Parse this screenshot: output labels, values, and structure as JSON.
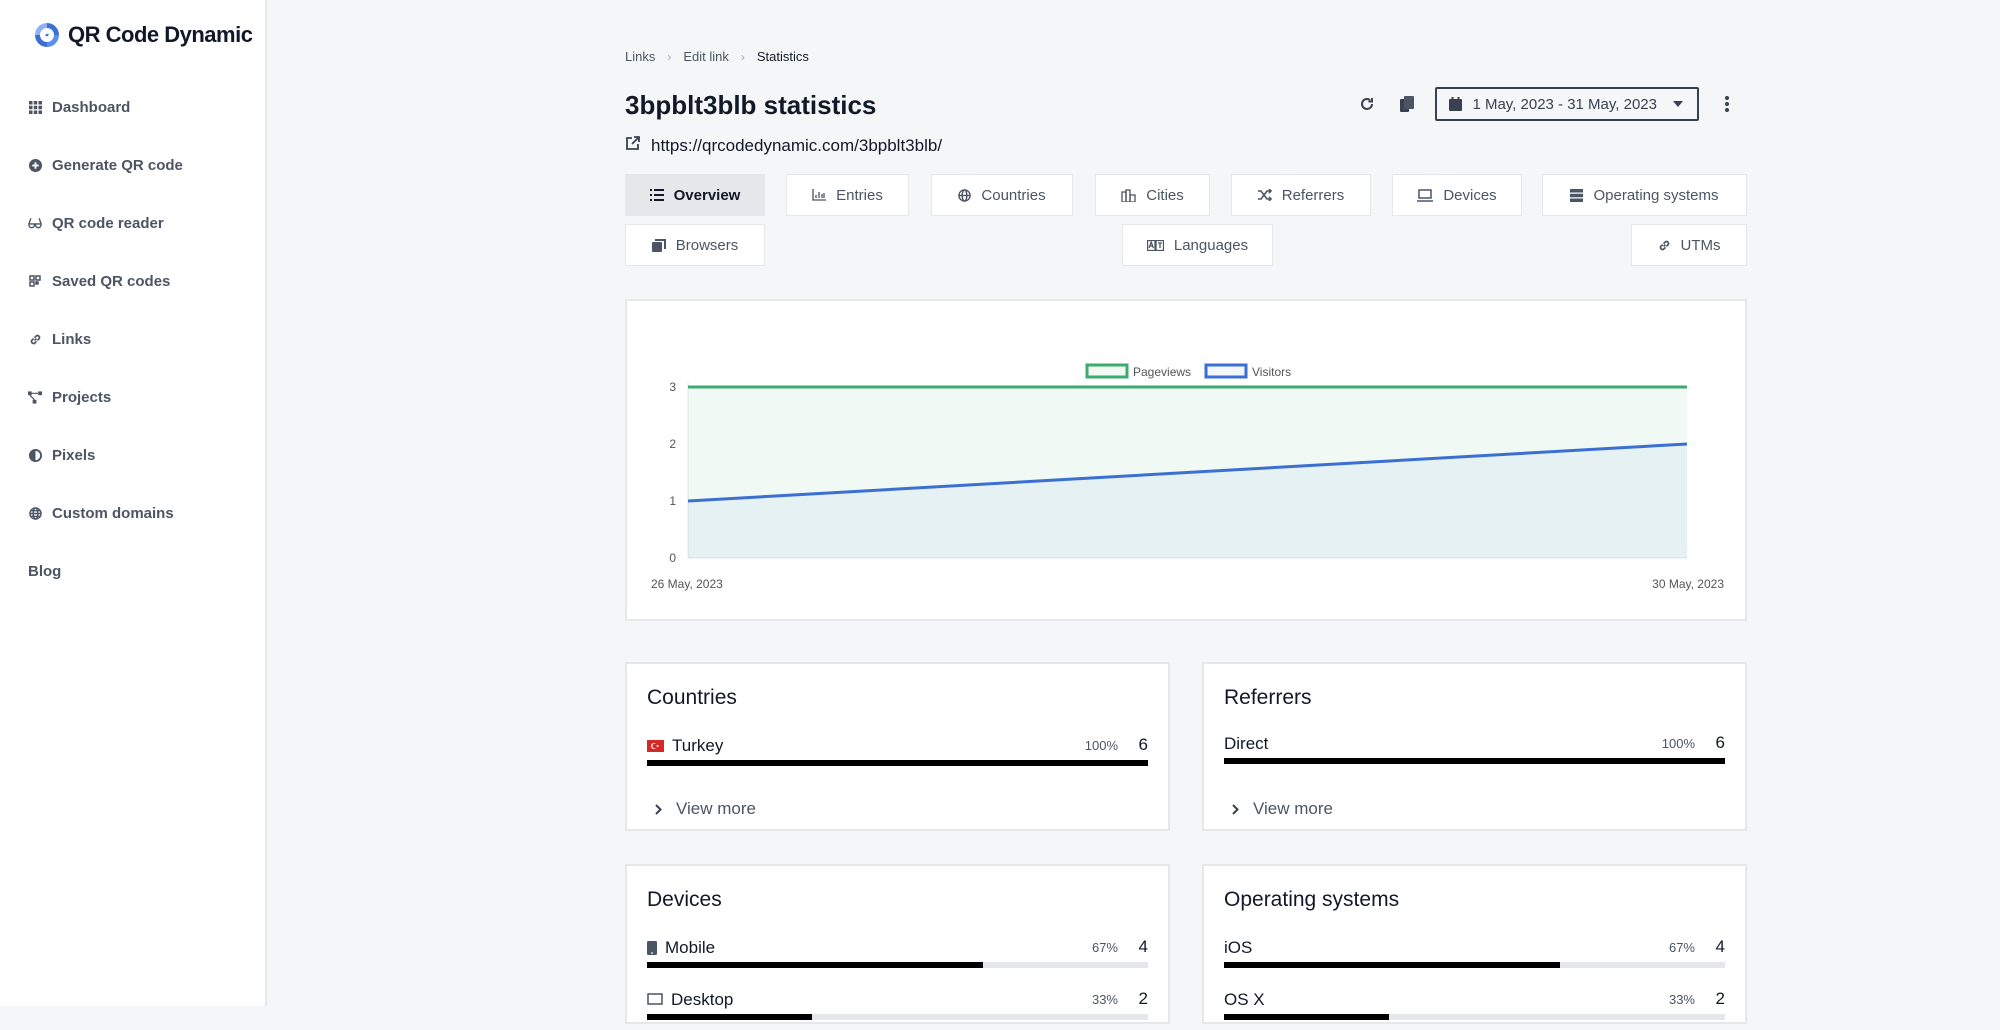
{
  "app": {
    "name": "QR Code Dynamic"
  },
  "sidebar": {
    "items": [
      {
        "label": "Dashboard",
        "icon": "grid-icon"
      },
      {
        "label": "Generate QR code",
        "icon": "plus-circle-icon"
      },
      {
        "label": "QR code reader",
        "icon": "glasses-icon"
      },
      {
        "label": "Saved QR codes",
        "icon": "qrcode-icon"
      },
      {
        "label": "Links",
        "icon": "link-icon"
      },
      {
        "label": "Projects",
        "icon": "project-diagram-icon"
      },
      {
        "label": "Pixels",
        "icon": "adjust-icon"
      },
      {
        "label": "Custom domains",
        "icon": "globe-icon"
      },
      {
        "label": "Blog",
        "icon": ""
      }
    ]
  },
  "breadcrumb": {
    "items": [
      "Links",
      "Edit link",
      "Statistics"
    ],
    "separator": "›"
  },
  "page": {
    "title": "3bpblt3blb statistics",
    "url": "https://qrcodedynamic.com/3bpblt3blb/"
  },
  "toolbar": {
    "refresh_icon": "refresh-icon",
    "copy_icon": "copy-icon",
    "date_range": "1 May, 2023 - 31 May, 2023",
    "more_icon": "more-vertical-icon"
  },
  "tabs": [
    {
      "label": "Overview",
      "icon": "list-icon",
      "active": true
    },
    {
      "label": "Entries",
      "icon": "chart-bar-icon"
    },
    {
      "label": "Countries",
      "icon": "globe-icon"
    },
    {
      "label": "Cities",
      "icon": "city-icon"
    },
    {
      "label": "Referrers",
      "icon": "random-icon"
    },
    {
      "label": "Devices",
      "icon": "laptop-icon"
    },
    {
      "label": "Operating systems",
      "icon": "server-icon"
    },
    {
      "label": "Browsers",
      "icon": "window-restore-icon"
    },
    {
      "label": "Languages",
      "icon": "language-icon"
    },
    {
      "label": "UTMs",
      "icon": "link-icon"
    }
  ],
  "colors": {
    "pageviews": "#3bab6f",
    "visitors": "#3b6fd1",
    "bar_fill": "#000000",
    "bar_track": "#e5e7eb"
  },
  "chart_data": {
    "type": "area",
    "title": "",
    "x": [
      "26 May, 2023",
      "30 May, 2023"
    ],
    "x_tick_labels": [
      "26 May, 2023",
      "30 May, 2023"
    ],
    "series": [
      {
        "name": "Pageviews",
        "values": [
          3,
          3
        ]
      },
      {
        "name": "Visitors",
        "values": [
          1,
          2
        ]
      }
    ],
    "y_ticks": [
      "0",
      "1",
      "2",
      "3"
    ],
    "ylim": [
      0,
      3
    ],
    "xlabel": "",
    "ylabel": "",
    "legend": "top-center",
    "grid": false
  },
  "stats": {
    "countries": {
      "title": "Countries",
      "rows": [
        {
          "label": "Turkey",
          "flag": "turkey-flag-icon",
          "percent": 100,
          "percent_label": "100%",
          "count": "6"
        }
      ],
      "view_more": "View more"
    },
    "referrers": {
      "title": "Referrers",
      "rows": [
        {
          "label": "Direct",
          "percent": 100,
          "percent_label": "100%",
          "count": "6"
        }
      ],
      "view_more": "View more"
    },
    "devices": {
      "title": "Devices",
      "rows": [
        {
          "label": "Mobile",
          "icon": "mobile-icon",
          "percent": 67,
          "percent_label": "67%",
          "count": "4"
        },
        {
          "label": "Desktop",
          "icon": "desktop-icon",
          "percent": 33,
          "percent_label": "33%",
          "count": "2"
        }
      ]
    },
    "operating_systems": {
      "title": "Operating systems",
      "rows": [
        {
          "label": "iOS",
          "percent": 67,
          "percent_label": "67%",
          "count": "4"
        },
        {
          "label": "OS X",
          "percent": 33,
          "percent_label": "33%",
          "count": "2"
        }
      ]
    }
  }
}
